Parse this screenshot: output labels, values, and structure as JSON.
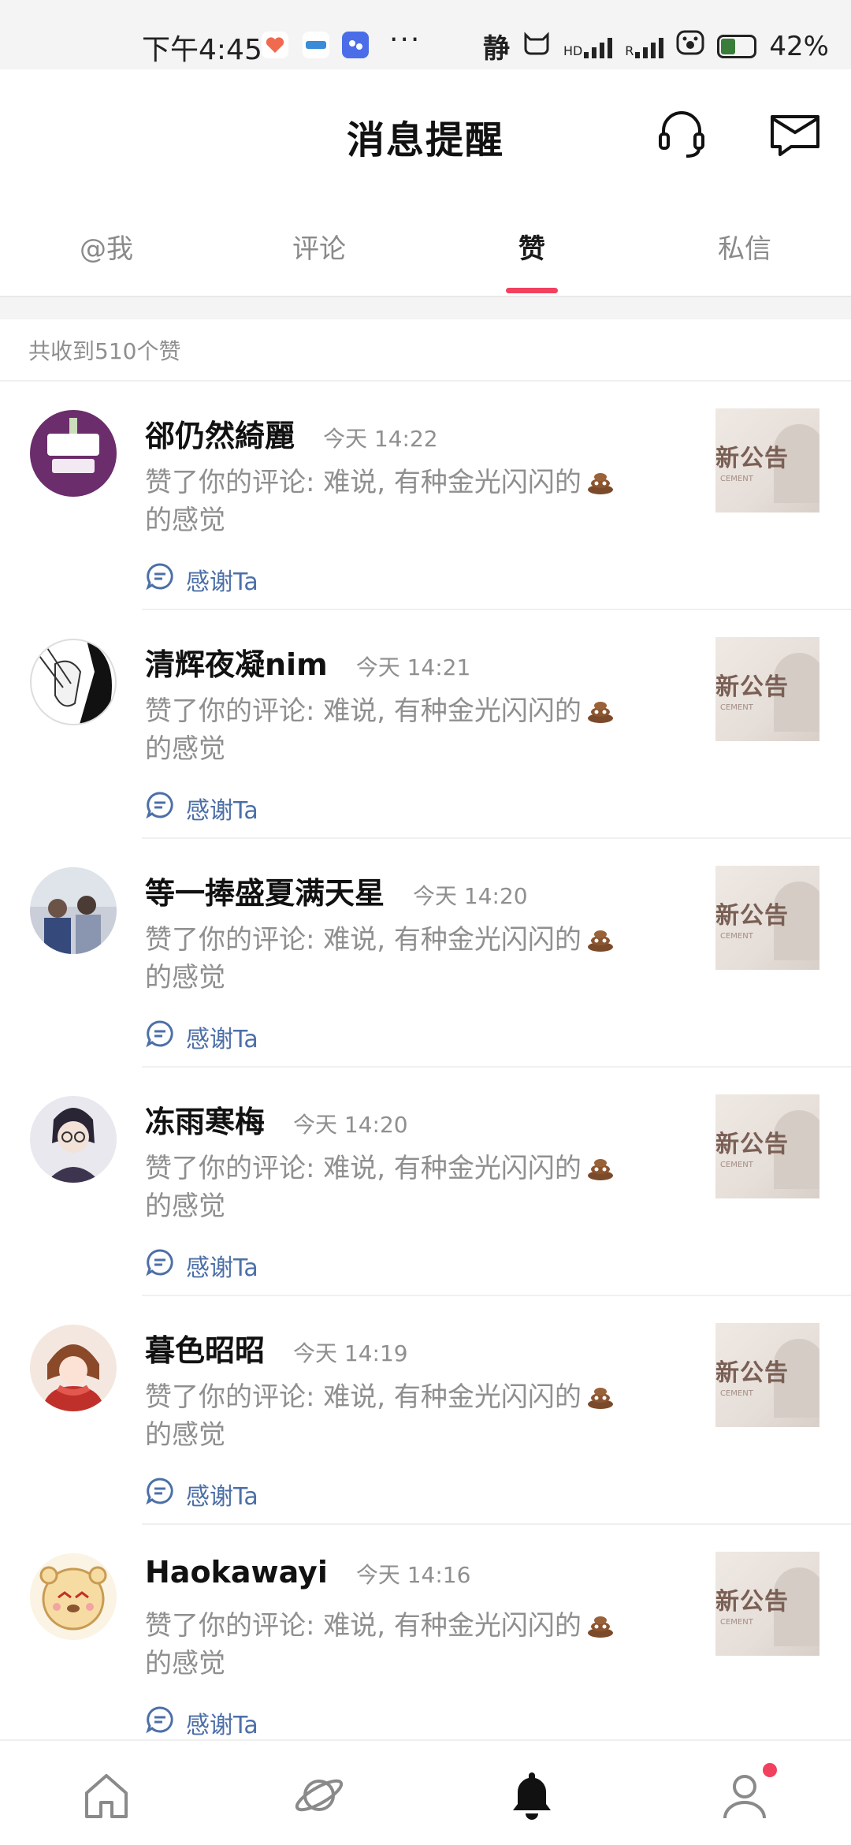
{
  "status_bar": {
    "time": "下午4:45",
    "mode": "静",
    "network_hd": "HD",
    "network_r": "R",
    "battery": "42%",
    "more": "···"
  },
  "header": {
    "title": "消息提醒"
  },
  "tabs": [
    {
      "label": "@我",
      "active": false
    },
    {
      "label": "评论",
      "active": false
    },
    {
      "label": "赞",
      "active": true
    },
    {
      "label": "私信",
      "active": false
    }
  ],
  "summary": "共收到510个赞",
  "items": [
    {
      "name": "郤仍然綺麗",
      "time": "今天 14:22",
      "message": "赞了你的评论: 难说, 有种金光闪闪的",
      "message_tail": "的感觉",
      "thanks": "感谢Ta",
      "thumb_text": "新公告",
      "thumb_sub": "CEMENT",
      "avatar_color": "#6b2d6b"
    },
    {
      "name": "清辉夜凝nim",
      "time": "今天 14:21",
      "message": "赞了你的评论: 难说, 有种金光闪闪的",
      "message_tail": "的感觉",
      "thanks": "感谢Ta",
      "thumb_text": "新公告",
      "thumb_sub": "CEMENT",
      "avatar_color": "#2b2b2b"
    },
    {
      "name": "等一捧盛夏满天星",
      "time": "今天 14:20",
      "message": "赞了你的评论: 难说, 有种金光闪闪的",
      "message_tail": "的感觉",
      "thanks": "感谢Ta",
      "thumb_text": "新公告",
      "thumb_sub": "CEMENT",
      "avatar_color": "#8a95a8"
    },
    {
      "name": "冻雨寒梅",
      "time": "今天 14:20",
      "message": "赞了你的评论: 难说, 有种金光闪闪的",
      "message_tail": "的感觉",
      "thanks": "感谢Ta",
      "thumb_text": "新公告",
      "thumb_sub": "CEMENT",
      "avatar_color": "#3d3550"
    },
    {
      "name": "暮色昭昭",
      "time": "今天 14:19",
      "message": "赞了你的评论: 难说, 有种金光闪闪的",
      "message_tail": "的感觉",
      "thanks": "感谢Ta",
      "thumb_text": "新公告",
      "thumb_sub": "CEMENT",
      "avatar_color": "#a8362f"
    },
    {
      "name": "Haokawayi",
      "time": "今天 14:16",
      "message": "赞了你的评论: 难说, 有种金光闪闪的",
      "message_tail": "的感觉",
      "thanks": "感谢Ta",
      "thumb_text": "新公告",
      "thumb_sub": "CEMENT",
      "avatar_color": "#f1d9a6"
    }
  ],
  "colors": {
    "accent": "#f2405f",
    "link": "#4c6fa7",
    "muted": "#8f8f8f"
  },
  "icons": {
    "header": [
      "headset-icon",
      "mail-icon"
    ],
    "bottom_nav": [
      "home-icon",
      "planet-icon",
      "bell-icon",
      "profile-icon"
    ]
  }
}
